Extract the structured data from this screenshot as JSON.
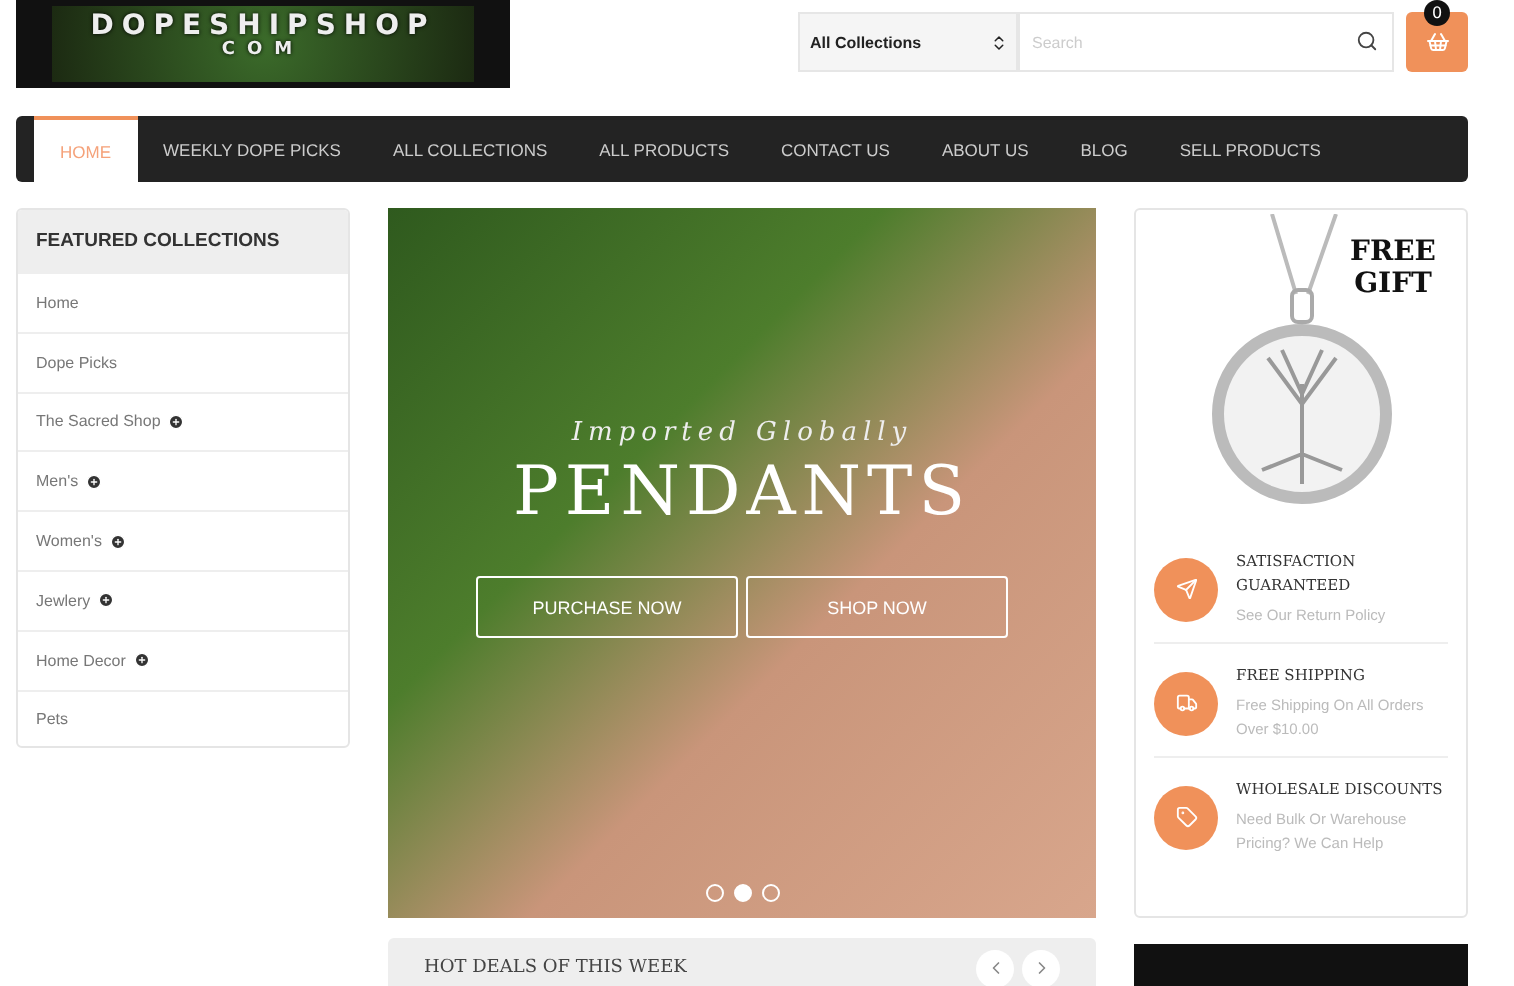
{
  "logo": {
    "text": "DOPESHIPSHOP",
    "subtext": "COM"
  },
  "header": {
    "collection_select": "All Collections",
    "search": {
      "placeholder": "Search"
    },
    "cart_count": "0"
  },
  "nav": [
    {
      "label": "HOME",
      "selected": true
    },
    {
      "label": "WEEKLY DOPE PICKS",
      "selected": false
    },
    {
      "label": "ALL COLLECTIONS",
      "selected": false
    },
    {
      "label": "ALL PRODUCTS",
      "selected": false
    },
    {
      "label": "CONTACT US",
      "selected": false
    },
    {
      "label": "ABOUT US",
      "selected": false
    },
    {
      "label": "BLOG",
      "selected": false
    },
    {
      "label": "SELL PRODUCTS",
      "selected": false
    }
  ],
  "sidebar": {
    "title": "FEATURED COLLECTIONS",
    "items": [
      {
        "label": "Home",
        "expandable": false
      },
      {
        "label": "Dope Picks",
        "expandable": false
      },
      {
        "label": "The Sacred Shop",
        "expandable": true
      },
      {
        "label": "Men's",
        "expandable": true
      },
      {
        "label": "Women's",
        "expandable": true
      },
      {
        "label": "Jewlery",
        "expandable": true
      },
      {
        "label": "Home Decor",
        "expandable": true
      },
      {
        "label": "Pets",
        "expandable": false
      }
    ]
  },
  "hero": {
    "subtitle": "Imported Globally",
    "title": "PENDANTS",
    "buttons": [
      "PURCHASE NOW",
      "SHOP NOW"
    ],
    "dots": [
      {
        "selected": false
      },
      {
        "selected": true
      },
      {
        "selected": false
      }
    ]
  },
  "hot_deals": {
    "title": "HOT DEALS OF THIS WEEK"
  },
  "promo": {
    "badge": "FREE GIFT",
    "features": [
      {
        "kind": "plane",
        "title": "SATISFACTION GUARANTEED",
        "text": "See Our Return Policy"
      },
      {
        "kind": "truck",
        "title": "FREE SHIPPING",
        "text": "Free Shipping On All Orders Over $10.00"
      },
      {
        "kind": "tag",
        "title": "WHOLESALE DISCOUNTS",
        "text": "Need Bulk Or Warehouse Pricing? We Can Help"
      }
    ]
  }
}
